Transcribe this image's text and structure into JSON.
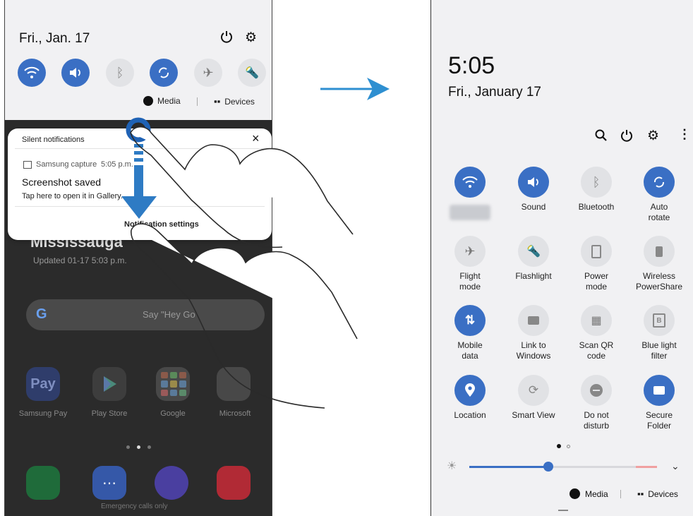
{
  "left": {
    "date": "Fri., Jan. 17",
    "media_label": "Media",
    "devices_label": "Devices",
    "notification": {
      "header": "Silent notifications",
      "close": "×",
      "app": "Samsung capture",
      "time": "5:05 p.m.",
      "title": "Screenshot saved",
      "body": "Tap here to open it in Gallery.",
      "settings": "Notification settings"
    },
    "home": {
      "city": "Mississauga",
      "updated": "Updated 01-17 5:03 p.m.",
      "search_hint": "Say \"Hey Go",
      "apps": [
        "Samsung Pay",
        "Play Store",
        "Google",
        "Microsoft"
      ],
      "pay_text": "Pay",
      "dock_caption": "Emergency calls only"
    }
  },
  "right": {
    "time": "5:05",
    "date": "Fri., January 17",
    "tiles": [
      {
        "label": "Sound"
      },
      {
        "label": "Bluetooth"
      },
      {
        "label": "Auto\nrotate"
      },
      {
        "label": "Flight\nmode"
      },
      {
        "label": "Flashlight"
      },
      {
        "label": "Power\nmode"
      },
      {
        "label": "Wireless\nPowerShare"
      },
      {
        "label": "Mobile\ndata"
      },
      {
        "label": "Link to\nWindows"
      },
      {
        "label": "Scan QR\ncode"
      },
      {
        "label": "Blue light\nfilter"
      },
      {
        "label": "Location"
      },
      {
        "label": "Smart View"
      },
      {
        "label": "Do not\ndisturb"
      },
      {
        "label": "Secure\nFolder"
      }
    ],
    "brightness": 0.42,
    "media_label": "Media",
    "devices_label": "Devices"
  },
  "colors": {
    "accent": "#3a6fc4",
    "arrow": "#2e8fd1",
    "tile_off": "#e1e2e5"
  }
}
